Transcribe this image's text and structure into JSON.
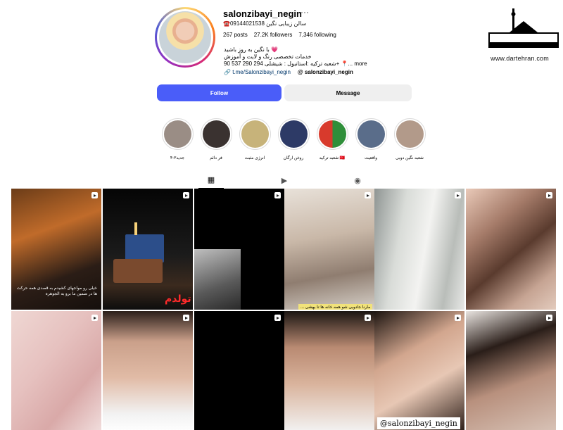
{
  "profile": {
    "username": "salonzibayi_negin",
    "more": "···",
    "phone_line": "☎️09144021538 سالن زیبایی نگین",
    "stats": {
      "posts": "267 posts",
      "followers": "27.2K followers",
      "following": "7,346 following"
    },
    "bio_lines": [
      "💗 با نگین به روز باشید",
      "خدمات تخصصی رنگ و لایت و آموزش",
      "شعبه ترکیه :استانبول : شیشلی 294 290 537 90+ 📍... more"
    ],
    "link": "t.me/Salonzibayi_negin",
    "threads": "salonzibayi_negin",
    "follow_label": "Follow",
    "message_label": "Message"
  },
  "highlights": [
    {
      "label": "۴-۳جدید",
      "color": "#9a8d85"
    },
    {
      "label": "فر دائم",
      "color": "#3a3230"
    },
    {
      "label": "انرژی مثبت",
      "color": "#c7b37a"
    },
    {
      "label": "روغن ارگان",
      "color": "#2d3a66"
    },
    {
      "label": "شعبه ترکیه 🇹🇷",
      "color": "#d83a2c"
    },
    {
      "label": "وافعیت",
      "color": "#5a6d8a"
    },
    {
      "label": "شعبه نگین دوبی",
      "color": "#b29a8a"
    }
  ],
  "tabs": [
    {
      "name": "posts",
      "icon": "▦"
    },
    {
      "name": "reels",
      "icon": "▶"
    },
    {
      "name": "tagged",
      "icon": "◉"
    }
  ],
  "grid": {
    "row1": [
      {
        "name": "post-makeup-session",
        "caption": "خیلی رو مواجهای کشیدم به قصدی همه حرکت ها در ضمین ما برو به الجوهره"
      },
      {
        "name": "post-birthday-cake",
        "bigtext": "تولدم"
      },
      {
        "name": "post-bw-portrait"
      },
      {
        "name": "post-salon-class",
        "caption": "مارنا جادویی شو همه خانه ها تا بهشی ..."
      },
      {
        "name": "post-silver-hair"
      },
      {
        "name": "post-nails-nude"
      }
    ],
    "row2": [
      {
        "name": "post-pink-nails"
      },
      {
        "name": "post-bride-makeup"
      },
      {
        "name": "post-black-reel"
      },
      {
        "name": "post-makeup-closeup"
      },
      {
        "name": "post-brow-tint",
        "handle": "@salonzibayi_negin"
      },
      {
        "name": "post-glam-look"
      }
    ]
  },
  "watermark": {
    "url": "www.dartehran.com",
    "logo_text": "در تهـــران"
  }
}
